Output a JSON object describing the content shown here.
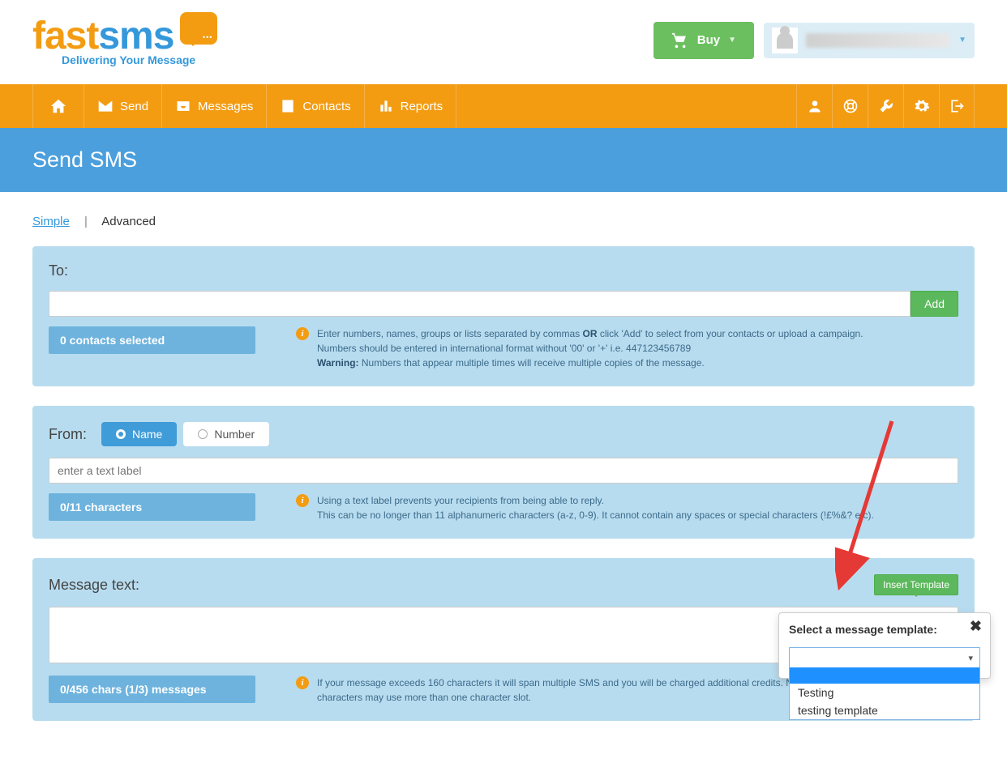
{
  "logo": {
    "part1": "fast",
    "part2": "sms",
    "tagline": "Delivering Your Message"
  },
  "header": {
    "buy_label": "Buy"
  },
  "nav": {
    "send": "Send",
    "messages": "Messages",
    "contacts": "Contacts",
    "reports": "Reports"
  },
  "page_title": "Send SMS",
  "tabs": {
    "simple": "Simple",
    "sep": "|",
    "advanced": "Advanced"
  },
  "to": {
    "label": "To:",
    "add_btn": "Add",
    "status_count": "0",
    "status_text": " contacts selected",
    "help1": "Enter numbers, names, groups or lists separated by commas ",
    "help_or": "OR",
    "help1b": " click 'Add' to select from your contacts or upload a campaign.",
    "help2": "Numbers should be entered in international format without '00' or '+' i.e. 447123456789",
    "help3_label": "Warning:",
    "help3_text": " Numbers that appear multiple times will receive multiple copies of the message."
  },
  "from": {
    "label": "From:",
    "opt_name": "Name",
    "opt_number": "Number",
    "placeholder": "enter a text label",
    "status_count": "0/11",
    "status_text": " characters",
    "help1": "Using a text label prevents your recipients from being able to reply.",
    "help2": "This can be no longer than 11 alphanumeric characters (a-z, 0-9). It cannot contain any spaces or special characters (!£%&? etc)."
  },
  "msg": {
    "label": "Message text:",
    "insert_btn": "Insert Template",
    "status_count": "0/456",
    "status_text1": " chars ",
    "status_count2": "(1/3)",
    "status_text2": " messages",
    "help1": "If your message exceeds 160 characters it will span multiple SMS and you will be charged additional credits. Note that",
    "help2": "characters may use more than one character slot."
  },
  "popover": {
    "title": "Select a message template:",
    "options": [
      "Testing",
      "testing template"
    ]
  }
}
